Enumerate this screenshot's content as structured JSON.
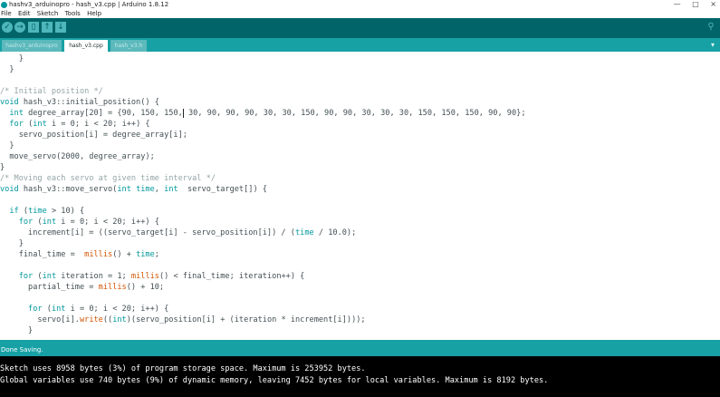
{
  "window": {
    "title": "hashv3_arduinopro - hash_v3.cpp | Arduino 1.8.12",
    "controls": [
      "—",
      "□",
      "×"
    ]
  },
  "menu": {
    "items": [
      "File",
      "Edit",
      "Sketch",
      "Tools",
      "Help"
    ]
  },
  "toolbar": {
    "verify_icon": "check-icon",
    "upload_icon": "arrow-right-icon",
    "new_icon": "new-file-icon",
    "open_icon": "arrow-up-icon",
    "save_icon": "arrow-down-icon",
    "serial_icon": "magnifier-icon"
  },
  "tabs": [
    {
      "label": "hashv3_arduinopro",
      "active": false
    },
    {
      "label": "hash_v3.cpp",
      "active": true
    },
    {
      "label": "hash_v3.h",
      "active": false
    }
  ],
  "editor": {
    "lines": [
      "    }",
      "  }",
      "",
      "/* Initial position */",
      "void hash_v3::initial_position() {",
      "  int degree_array[20] = {90, 150, 150, 30, 90, 90, 90, 30, 30, 150, 90, 90, 30, 30, 30, 150, 150, 150, 90, 90};",
      "  for (int i = 0; i < 20; i++) {",
      "    servo_position[i] = degree_array[i];",
      "  }",
      "  move_servo(2000, degree_array);",
      "}",
      "/* Moving each servo at given time interval */",
      "void hash_v3::move_servo(int time, int  servo_target[]) {",
      "",
      "  if (time > 10) {",
      "    for (int i = 0; i < 20; i++) {",
      "      increment[i] = ((servo_target[i] - servo_position[i]) / (time / 10.0);",
      "    }",
      "    final_time =  millis() + time;",
      "",
      "    for (int iteration = 1; millis() < final_time; iteration++) {",
      "      partial_time = millis() + 10;",
      "",
      "      for (int i = 0; i < 20; i++) {",
      "        servo[i].write((int)(servo_position[i] + (iteration * increment[i])));",
      "      }"
    ]
  },
  "status": {
    "message": "Done Saving."
  },
  "console": {
    "lines": [
      "Sketch uses 8958 bytes (3%) of program storage space. Maximum is 253952 bytes.",
      "Global variables use 740 bytes (9%) of dynamic memory, leaving 7452 bytes for local variables. Maximum is 8192 bytes."
    ]
  },
  "colors": {
    "toolbar": "#006468",
    "tab_bar": "#17a1a5",
    "keyword": "#00979c",
    "function": "#d35400",
    "comment": "#95a5a6",
    "console_bg": "#000000"
  }
}
